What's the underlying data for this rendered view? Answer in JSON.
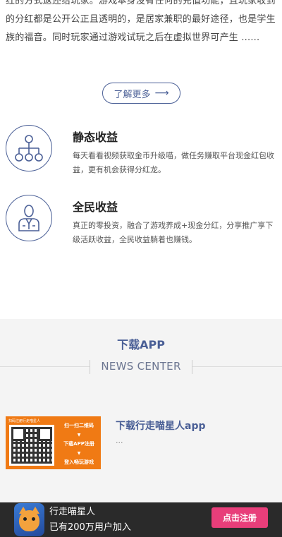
{
  "intro": {
    "text": "红的方式返还给玩家。游戏本身没有任何的充值功能，且玩家收到的分红都是公开公正且透明的，是居家兼职的最好途径，也是学生族的福音。同时玩家通过游戏试玩之后在虚拟世界可产生 ......"
  },
  "more_button": {
    "label": "了解更多",
    "arrow": "⟶"
  },
  "features": [
    {
      "title": "静态收益",
      "desc": "每天看看视频获取金币升级喵，做任务赚取平台现金红包收益，更有机会获得分红龙。",
      "icon": "network-tree-icon"
    },
    {
      "title": "全民收益",
      "desc": "真正的零投资，融合了游戏养成+现金分红，分享推广享下级活跃收益，全民收益躺着也赚钱。",
      "icon": "businessman-icon"
    }
  ],
  "download_section": {
    "title": "下载APP",
    "subtitle": "NEWS CENTER"
  },
  "news_item": {
    "title": "下载行走喵星人app",
    "excerpt": "...",
    "image": {
      "head_text": "扫码注册行走喵星人",
      "steps": [
        "扫一扫二维码",
        "下载APP注册",
        "登入畅玩游戏"
      ],
      "step_arrow": "▼"
    }
  },
  "bottom_bar": {
    "app_name": "行走喵星人",
    "users_text": "已有200万用户加入",
    "register_label": "点击注册"
  },
  "colors": {
    "accent": "#4a5f96",
    "orange": "#f07a14",
    "pink_button": "#e83e7a",
    "bottom_bar_bg": "#2a2a2a",
    "section_bg": "#f4f4f4"
  }
}
